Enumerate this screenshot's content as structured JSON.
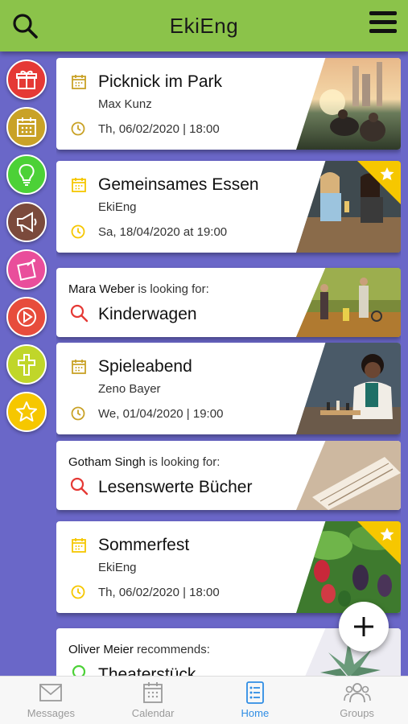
{
  "header": {
    "title": "EkiEng"
  },
  "colors": {
    "header": "#8bc34a",
    "background": "#6a67c8",
    "accent": "#2f8de4",
    "star": "#f6c700"
  },
  "sidebar": {
    "categories": [
      {
        "icon": "gift-icon",
        "color": "#e53935"
      },
      {
        "icon": "calendar-icon",
        "color": "#c9a227"
      },
      {
        "icon": "lightbulb-icon",
        "color": "#4cd137"
      },
      {
        "icon": "megaphone-icon",
        "color": "#7b4a3c"
      },
      {
        "icon": "pin-icon",
        "color": "#e94e9b"
      },
      {
        "icon": "play-icon",
        "color": "#e74c3c"
      },
      {
        "icon": "cross-icon",
        "color": "#c0d62a"
      },
      {
        "icon": "star-icon",
        "color": "#f6c700"
      }
    ]
  },
  "feed": {
    "card1": {
      "title": "Picknick im Park",
      "organizer": "Max Kunz",
      "date": "Th, 06/02/2020 | 18:00"
    },
    "card2": {
      "title": "Gemeinsames Essen",
      "organizer": "EkiEng",
      "date": "Sa, 18/04/2020 at 19:00",
      "starred": true
    },
    "card3": {
      "person": "Mara Weber",
      "action": " is looking for:",
      "item": "Kinderwagen"
    },
    "card4": {
      "title": "Spieleabend",
      "organizer": "Zeno Bayer",
      "date": "We, 01/04/2020 | 19:00"
    },
    "card5": {
      "person": "Gotham Singh",
      "action": " is looking for:",
      "item": "Lesenswerte Bücher"
    },
    "card6": {
      "title": "Sommerfest",
      "organizer": "EkiEng",
      "date": "Th, 06/02/2020 | 18:00",
      "starred": true
    },
    "card7": {
      "person": "Oliver Meier",
      "action": " recommends:",
      "item": "Theaterstück"
    }
  },
  "bottom_nav": {
    "messages": "Messages",
    "calendar": "Calendar",
    "home": "Home",
    "groups": "Groups"
  }
}
